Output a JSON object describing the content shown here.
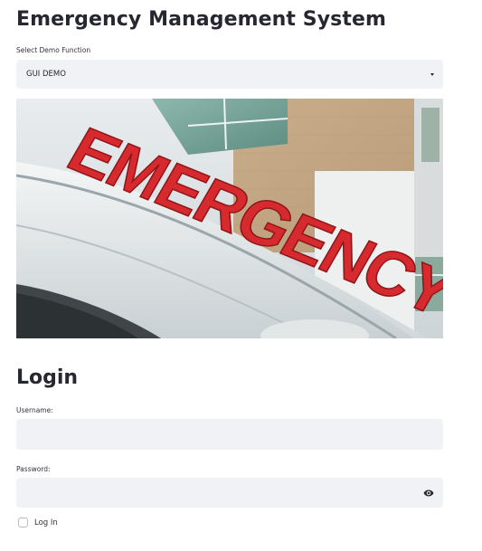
{
  "header": {
    "title": "Emergency Management System"
  },
  "demo_select": {
    "label": "Select Demo Function",
    "value": "GUI DEMO"
  },
  "hero_image": {
    "sign_text": "EMERGENCY"
  },
  "login": {
    "title": "Login",
    "username_label": "Username:",
    "username_value": "",
    "password_label": "Password:",
    "password_value": "",
    "checkbox_label": "Log In",
    "checkbox_checked": false
  },
  "colors": {
    "input_bg": "#f0f2f6",
    "text": "#262730",
    "sign_red": "#d62a2f"
  }
}
